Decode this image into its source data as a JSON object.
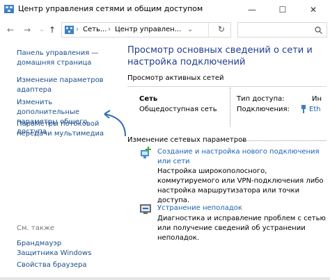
{
  "window": {
    "title": "Центр управления сетями и общим доступом",
    "minimize": "—",
    "maximize": "☐",
    "close": "✕"
  },
  "nav": {
    "back": "←",
    "forward": "→",
    "up": "↑",
    "dropdown": "⌄",
    "refresh": "↻",
    "breadcrumb": [
      "Сеть...",
      "Центр управлен..."
    ],
    "crumb_sep": "›",
    "search_placeholder": ""
  },
  "sidebar": {
    "items": [
      {
        "label": "Панель управления — домашняя страница"
      },
      {
        "label": "Изменение параметров адаптера"
      },
      {
        "label": "Изменить дополнительные параметры общего доступа"
      },
      {
        "label": "Параметры потоковой передачи мультимедиа"
      }
    ],
    "see_also_title": "См. также",
    "see_also": [
      {
        "label": "Брандмауэр Защитника Windows"
      },
      {
        "label": "Свойства браузера"
      }
    ]
  },
  "main": {
    "title": "Просмотр основных сведений о сети и настройка подключений",
    "active_networks_header": "Просмотр активных сетей",
    "network": {
      "name": "Сеть",
      "type": "Общедоступная сеть",
      "access_label": "Тип доступа:",
      "access_value": "Ин",
      "connections_label": "Подключения:",
      "connections_value": "Eth"
    },
    "change_header": "Изменение сетевых параметров",
    "tasks": [
      {
        "link": "Создание и настройка нового подключения или сети",
        "desc": "Настройка широкополосного, коммутируемого или VPN-подключения либо настройка маршрутизатора или точки доступа."
      },
      {
        "link": "Устранение неполадок",
        "desc": "Диагностика и исправление проблем с сетью или получение сведений об устранении неполадок."
      }
    ]
  },
  "colors": {
    "link": "#1a4e8a",
    "title_blue": "#1e3d8f",
    "arrow": "#2e6db4"
  }
}
